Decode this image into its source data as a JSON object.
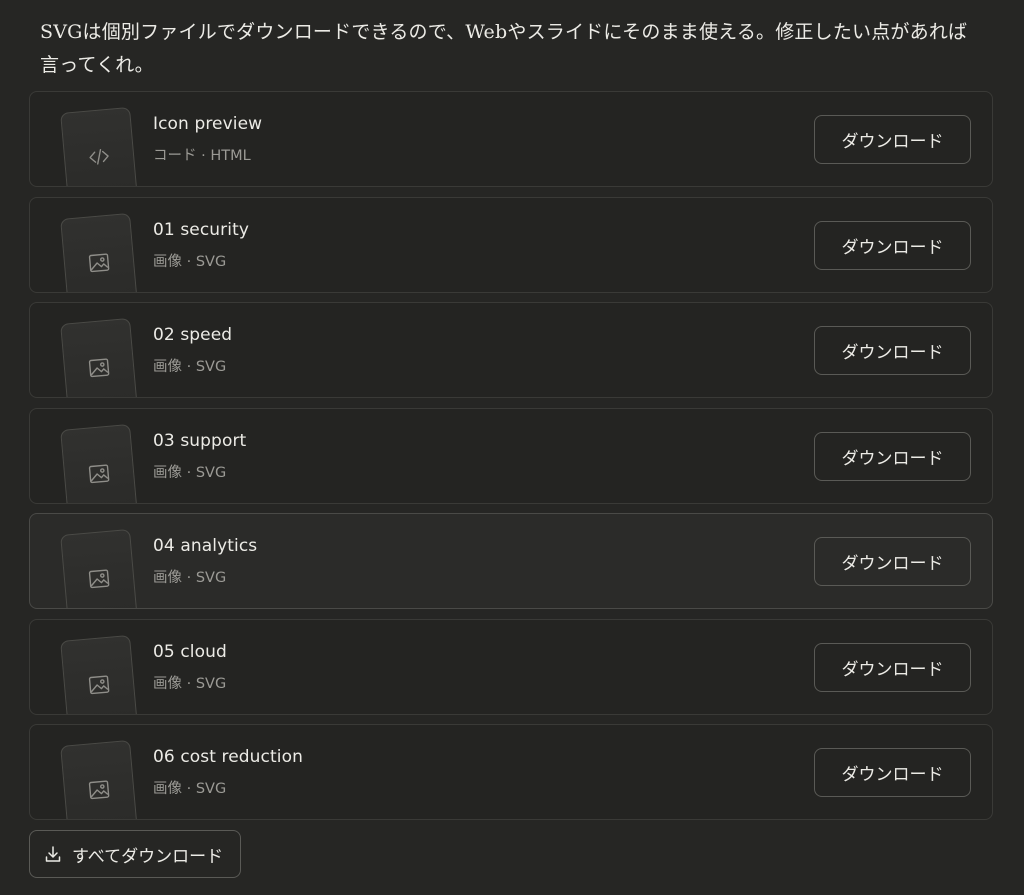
{
  "message": {
    "text": "SVGは個別ファイルでダウンロードできるので、Webやスライドにそのまま使える。修正したい点があれば言ってくれ。"
  },
  "files": [
    {
      "name": "Icon preview",
      "meta": "コード · HTML",
      "icon": "code-icon",
      "button_label": "ダウンロード"
    },
    {
      "name": "01 security",
      "meta": "画像 · SVG",
      "icon": "image-icon",
      "button_label": "ダウンロード"
    },
    {
      "name": "02 speed",
      "meta": "画像 · SVG",
      "icon": "image-icon",
      "button_label": "ダウンロード"
    },
    {
      "name": "03 support",
      "meta": "画像 · SVG",
      "icon": "image-icon",
      "button_label": "ダウンロード"
    },
    {
      "name": "04 analytics",
      "meta": "画像 · SVG",
      "icon": "image-icon",
      "button_label": "ダウンロード"
    },
    {
      "name": "05 cloud",
      "meta": "画像 · SVG",
      "icon": "image-icon",
      "button_label": "ダウンロード"
    },
    {
      "name": "06 cost reduction",
      "meta": "画像 · SVG",
      "icon": "image-icon",
      "button_label": "ダウンロード"
    }
  ],
  "download_all": {
    "label": "すべてダウンロード",
    "icon": "download-icon"
  },
  "colors": {
    "background": "#262624",
    "card_background": "#242422",
    "card_border": "#3a3a37",
    "text_primary": "#ecebe6",
    "text_secondary": "#9b9a95"
  }
}
